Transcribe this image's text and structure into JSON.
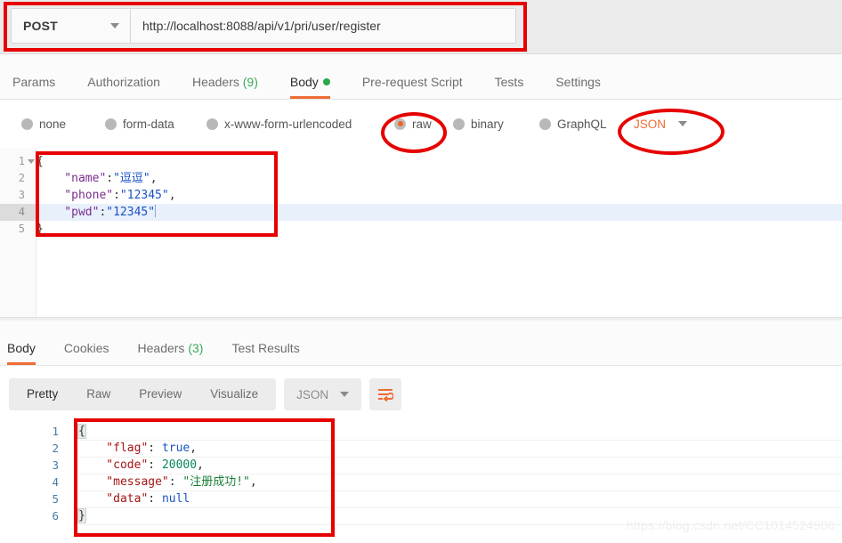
{
  "request": {
    "method": "POST",
    "url": "http://localhost:8088/api/v1/pri/user/register",
    "tabs": [
      {
        "label": "Params",
        "active": false,
        "count": "",
        "dot": false
      },
      {
        "label": "Authorization",
        "active": false,
        "count": "",
        "dot": false
      },
      {
        "label": "Headers",
        "active": false,
        "count": "(9)",
        "dot": false
      },
      {
        "label": "Body",
        "active": true,
        "count": "",
        "dot": true
      },
      {
        "label": "Pre-request Script",
        "active": false,
        "count": "",
        "dot": false
      },
      {
        "label": "Tests",
        "active": false,
        "count": "",
        "dot": false
      },
      {
        "label": "Settings",
        "active": false,
        "count": "",
        "dot": false
      }
    ],
    "body_types": [
      {
        "label": "none",
        "selected": false
      },
      {
        "label": "form-data",
        "selected": false
      },
      {
        "label": "x-www-form-urlencoded",
        "selected": false
      },
      {
        "label": "raw",
        "selected": true
      },
      {
        "label": "binary",
        "selected": false
      },
      {
        "label": "GraphQL",
        "selected": false
      }
    ],
    "raw_format": "JSON",
    "editor": {
      "lines": [
        {
          "no": "1",
          "fold": true,
          "highlight": false,
          "tokens": [
            {
              "t": "{",
              "c": "tk-punct"
            }
          ]
        },
        {
          "no": "2",
          "fold": false,
          "highlight": false,
          "tokens": [
            {
              "t": "    \"name\"",
              "c": "tk-key"
            },
            {
              "t": ":",
              "c": "tk-punct"
            },
            {
              "t": "\"逗逗\"",
              "c": "tk-str"
            },
            {
              "t": ",",
              "c": "tk-punct"
            }
          ]
        },
        {
          "no": "3",
          "fold": false,
          "highlight": false,
          "tokens": [
            {
              "t": "    \"phone\"",
              "c": "tk-key"
            },
            {
              "t": ":",
              "c": "tk-punct"
            },
            {
              "t": "\"12345\"",
              "c": "tk-str"
            },
            {
              "t": ",",
              "c": "tk-punct"
            }
          ]
        },
        {
          "no": "4",
          "fold": false,
          "highlight": true,
          "tokens": [
            {
              "t": "    \"pwd\"",
              "c": "tk-key"
            },
            {
              "t": ":",
              "c": "tk-punct"
            },
            {
              "t": "\"12345\"",
              "c": "tk-str"
            }
          ]
        },
        {
          "no": "5",
          "fold": false,
          "highlight": false,
          "tokens": [
            {
              "t": "}",
              "c": "tk-punct"
            }
          ]
        }
      ]
    }
  },
  "response": {
    "tabs": [
      {
        "label": "Body",
        "active": true,
        "count": ""
      },
      {
        "label": "Cookies",
        "active": false,
        "count": ""
      },
      {
        "label": "Headers",
        "active": false,
        "count": "(3)"
      },
      {
        "label": "Test Results",
        "active": false,
        "count": ""
      }
    ],
    "view_modes": [
      {
        "label": "Pretty",
        "active": true
      },
      {
        "label": "Raw",
        "active": false
      },
      {
        "label": "Preview",
        "active": false
      },
      {
        "label": "Visualize",
        "active": false
      }
    ],
    "format": "JSON",
    "wrap_icon": "word-wrap-icon",
    "editor": {
      "lines": [
        {
          "no": "1",
          "tokens": [
            {
              "t": "{",
              "c": "rk-punct brace-match"
            }
          ]
        },
        {
          "no": "2",
          "tokens": [
            {
              "t": "    \"flag\"",
              "c": "rk-key"
            },
            {
              "t": ": ",
              "c": "rk-punct"
            },
            {
              "t": "true",
              "c": "rk-bool"
            },
            {
              "t": ",",
              "c": "rk-punct"
            }
          ]
        },
        {
          "no": "3",
          "tokens": [
            {
              "t": "    \"code\"",
              "c": "rk-key"
            },
            {
              "t": ": ",
              "c": "rk-punct"
            },
            {
              "t": "20000",
              "c": "rk-num"
            },
            {
              "t": ",",
              "c": "rk-punct"
            }
          ]
        },
        {
          "no": "4",
          "tokens": [
            {
              "t": "    \"message\"",
              "c": "rk-key"
            },
            {
              "t": ": ",
              "c": "rk-punct"
            },
            {
              "t": "\"注册成功!\"",
              "c": "rk-str"
            },
            {
              "t": ",",
              "c": "rk-punct"
            }
          ]
        },
        {
          "no": "5",
          "tokens": [
            {
              "t": "    \"data\"",
              "c": "rk-key"
            },
            {
              "t": ": ",
              "c": "rk-punct"
            },
            {
              "t": "null",
              "c": "rk-bool"
            }
          ]
        },
        {
          "no": "6",
          "tokens": [
            {
              "t": "}",
              "c": "rk-punct brace-match"
            }
          ]
        }
      ]
    }
  },
  "watermark": "https://blog.csdn.net/CC1014524900",
  "colors": {
    "accent_orange": "#ef6c35",
    "annotation_red": "#e60000",
    "green_badge": "#3bab5a"
  }
}
